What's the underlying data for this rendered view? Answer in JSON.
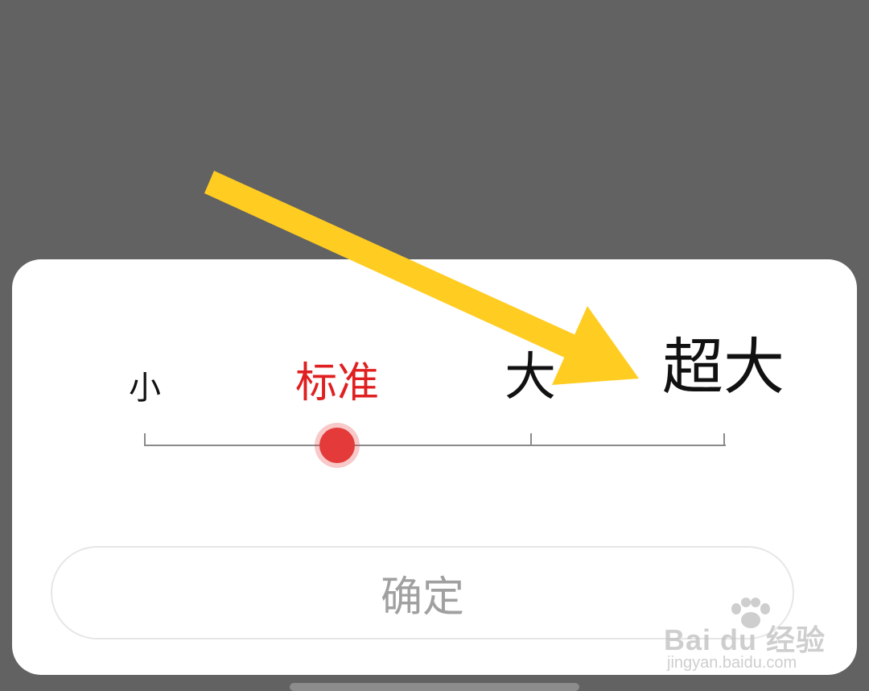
{
  "font_size_dialog": {
    "options": [
      {
        "label": "小",
        "selected": false
      },
      {
        "label": "标准",
        "selected": true
      },
      {
        "label": "大",
        "selected": false
      },
      {
        "label": "超大",
        "selected": false
      }
    ],
    "selected_index": 1,
    "confirm_label": "确定"
  },
  "annotation": {
    "arrow_color": "#FFCC22"
  },
  "watermark": {
    "brand": "Bai du 经验",
    "url": "jingyan.baidu.com"
  },
  "colors": {
    "backdrop": "#626262",
    "sheet": "#FFFFFF",
    "accent": "#E43A3A",
    "selected_label": "#E02020",
    "button_text": "#A0A0A0"
  }
}
